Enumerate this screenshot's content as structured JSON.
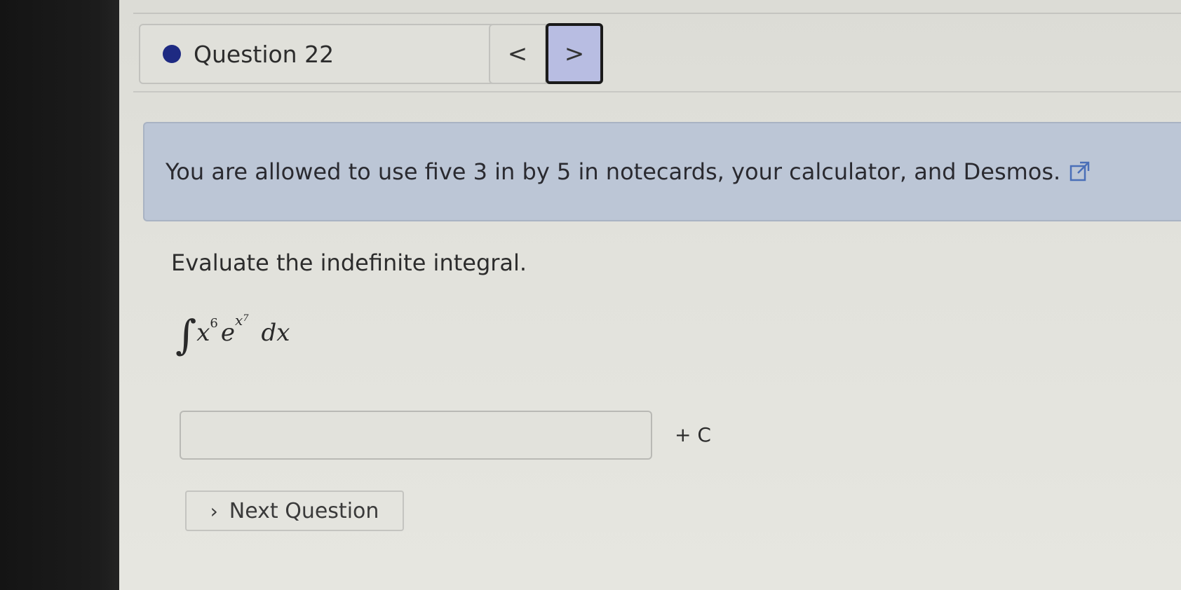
{
  "nav": {
    "question_label": "Question 22",
    "prev_symbol": "<",
    "next_symbol": ">"
  },
  "info": {
    "text": "You are allowed to use five 3 in by 5 in notecards, your calculator, and Desmos."
  },
  "problem": {
    "instruction": "Evaluate the indefinite integral.",
    "integral_sign": "∫",
    "base_var": "x",
    "base_power": "6",
    "exp_base": "e",
    "exp_var": "x",
    "exp_power": "7",
    "differential": "dx"
  },
  "answer": {
    "value": "",
    "constant": "+ C"
  },
  "footer": {
    "next_question_label": "Next Question"
  },
  "colors": {
    "status_dot": "#1e2a82",
    "info_box": "#bcc6d6",
    "active_nav": "#b8bde2"
  }
}
